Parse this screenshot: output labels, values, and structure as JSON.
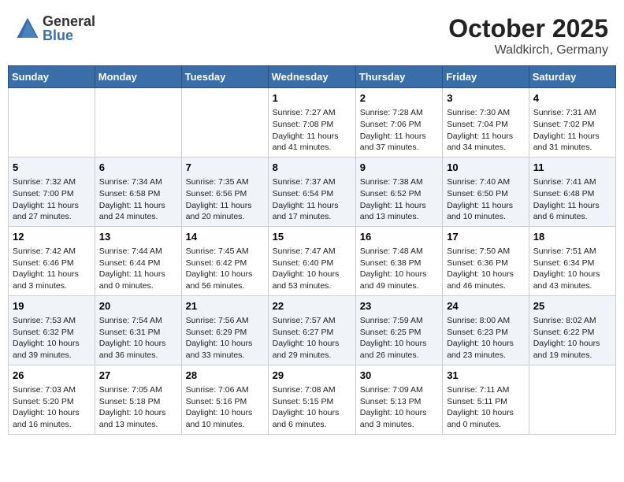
{
  "header": {
    "logo_general": "General",
    "logo_blue": "Blue",
    "month": "October 2025",
    "location": "Waldkirch, Germany"
  },
  "days_of_week": [
    "Sunday",
    "Monday",
    "Tuesday",
    "Wednesday",
    "Thursday",
    "Friday",
    "Saturday"
  ],
  "weeks": [
    [
      {
        "day": "",
        "sunrise": "",
        "sunset": "",
        "daylight": ""
      },
      {
        "day": "",
        "sunrise": "",
        "sunset": "",
        "daylight": ""
      },
      {
        "day": "",
        "sunrise": "",
        "sunset": "",
        "daylight": ""
      },
      {
        "day": "1",
        "sunrise": "Sunrise: 7:27 AM",
        "sunset": "Sunset: 7:08 PM",
        "daylight": "Daylight: 11 hours and 41 minutes."
      },
      {
        "day": "2",
        "sunrise": "Sunrise: 7:28 AM",
        "sunset": "Sunset: 7:06 PM",
        "daylight": "Daylight: 11 hours and 37 minutes."
      },
      {
        "day": "3",
        "sunrise": "Sunrise: 7:30 AM",
        "sunset": "Sunset: 7:04 PM",
        "daylight": "Daylight: 11 hours and 34 minutes."
      },
      {
        "day": "4",
        "sunrise": "Sunrise: 7:31 AM",
        "sunset": "Sunset: 7:02 PM",
        "daylight": "Daylight: 11 hours and 31 minutes."
      }
    ],
    [
      {
        "day": "5",
        "sunrise": "Sunrise: 7:32 AM",
        "sunset": "Sunset: 7:00 PM",
        "daylight": "Daylight: 11 hours and 27 minutes."
      },
      {
        "day": "6",
        "sunrise": "Sunrise: 7:34 AM",
        "sunset": "Sunset: 6:58 PM",
        "daylight": "Daylight: 11 hours and 24 minutes."
      },
      {
        "day": "7",
        "sunrise": "Sunrise: 7:35 AM",
        "sunset": "Sunset: 6:56 PM",
        "daylight": "Daylight: 11 hours and 20 minutes."
      },
      {
        "day": "8",
        "sunrise": "Sunrise: 7:37 AM",
        "sunset": "Sunset: 6:54 PM",
        "daylight": "Daylight: 11 hours and 17 minutes."
      },
      {
        "day": "9",
        "sunrise": "Sunrise: 7:38 AM",
        "sunset": "Sunset: 6:52 PM",
        "daylight": "Daylight: 11 hours and 13 minutes."
      },
      {
        "day": "10",
        "sunrise": "Sunrise: 7:40 AM",
        "sunset": "Sunset: 6:50 PM",
        "daylight": "Daylight: 11 hours and 10 minutes."
      },
      {
        "day": "11",
        "sunrise": "Sunrise: 7:41 AM",
        "sunset": "Sunset: 6:48 PM",
        "daylight": "Daylight: 11 hours and 6 minutes."
      }
    ],
    [
      {
        "day": "12",
        "sunrise": "Sunrise: 7:42 AM",
        "sunset": "Sunset: 6:46 PM",
        "daylight": "Daylight: 11 hours and 3 minutes."
      },
      {
        "day": "13",
        "sunrise": "Sunrise: 7:44 AM",
        "sunset": "Sunset: 6:44 PM",
        "daylight": "Daylight: 11 hours and 0 minutes."
      },
      {
        "day": "14",
        "sunrise": "Sunrise: 7:45 AM",
        "sunset": "Sunset: 6:42 PM",
        "daylight": "Daylight: 10 hours and 56 minutes."
      },
      {
        "day": "15",
        "sunrise": "Sunrise: 7:47 AM",
        "sunset": "Sunset: 6:40 PM",
        "daylight": "Daylight: 10 hours and 53 minutes."
      },
      {
        "day": "16",
        "sunrise": "Sunrise: 7:48 AM",
        "sunset": "Sunset: 6:38 PM",
        "daylight": "Daylight: 10 hours and 49 minutes."
      },
      {
        "day": "17",
        "sunrise": "Sunrise: 7:50 AM",
        "sunset": "Sunset: 6:36 PM",
        "daylight": "Daylight: 10 hours and 46 minutes."
      },
      {
        "day": "18",
        "sunrise": "Sunrise: 7:51 AM",
        "sunset": "Sunset: 6:34 PM",
        "daylight": "Daylight: 10 hours and 43 minutes."
      }
    ],
    [
      {
        "day": "19",
        "sunrise": "Sunrise: 7:53 AM",
        "sunset": "Sunset: 6:32 PM",
        "daylight": "Daylight: 10 hours and 39 minutes."
      },
      {
        "day": "20",
        "sunrise": "Sunrise: 7:54 AM",
        "sunset": "Sunset: 6:31 PM",
        "daylight": "Daylight: 10 hours and 36 minutes."
      },
      {
        "day": "21",
        "sunrise": "Sunrise: 7:56 AM",
        "sunset": "Sunset: 6:29 PM",
        "daylight": "Daylight: 10 hours and 33 minutes."
      },
      {
        "day": "22",
        "sunrise": "Sunrise: 7:57 AM",
        "sunset": "Sunset: 6:27 PM",
        "daylight": "Daylight: 10 hours and 29 minutes."
      },
      {
        "day": "23",
        "sunrise": "Sunrise: 7:59 AM",
        "sunset": "Sunset: 6:25 PM",
        "daylight": "Daylight: 10 hours and 26 minutes."
      },
      {
        "day": "24",
        "sunrise": "Sunrise: 8:00 AM",
        "sunset": "Sunset: 6:23 PM",
        "daylight": "Daylight: 10 hours and 23 minutes."
      },
      {
        "day": "25",
        "sunrise": "Sunrise: 8:02 AM",
        "sunset": "Sunset: 6:22 PM",
        "daylight": "Daylight: 10 hours and 19 minutes."
      }
    ],
    [
      {
        "day": "26",
        "sunrise": "Sunrise: 7:03 AM",
        "sunset": "Sunset: 5:20 PM",
        "daylight": "Daylight: 10 hours and 16 minutes."
      },
      {
        "day": "27",
        "sunrise": "Sunrise: 7:05 AM",
        "sunset": "Sunset: 5:18 PM",
        "daylight": "Daylight: 10 hours and 13 minutes."
      },
      {
        "day": "28",
        "sunrise": "Sunrise: 7:06 AM",
        "sunset": "Sunset: 5:16 PM",
        "daylight": "Daylight: 10 hours and 10 minutes."
      },
      {
        "day": "29",
        "sunrise": "Sunrise: 7:08 AM",
        "sunset": "Sunset: 5:15 PM",
        "daylight": "Daylight: 10 hours and 6 minutes."
      },
      {
        "day": "30",
        "sunrise": "Sunrise: 7:09 AM",
        "sunset": "Sunset: 5:13 PM",
        "daylight": "Daylight: 10 hours and 3 minutes."
      },
      {
        "day": "31",
        "sunrise": "Sunrise: 7:11 AM",
        "sunset": "Sunset: 5:11 PM",
        "daylight": "Daylight: 10 hours and 0 minutes."
      },
      {
        "day": "",
        "sunrise": "",
        "sunset": "",
        "daylight": ""
      }
    ]
  ]
}
